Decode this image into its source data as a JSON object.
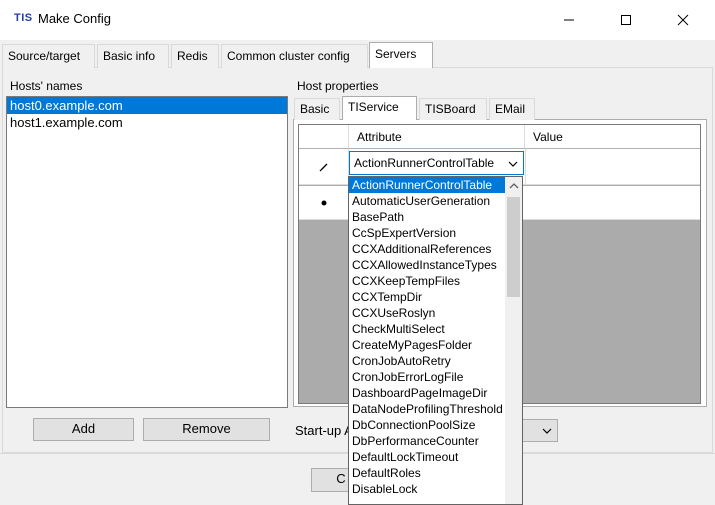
{
  "window": {
    "logo": "TIS",
    "title": "Make Config"
  },
  "tabs": [
    {
      "label": "Source/target"
    },
    {
      "label": "Basic info"
    },
    {
      "label": "Redis"
    },
    {
      "label": "Common cluster config"
    },
    {
      "label": "Servers",
      "active": true
    }
  ],
  "hosts": {
    "label": "Hosts' names",
    "items": [
      "host0.example.com",
      "host1.example.com"
    ],
    "selected_index": 0,
    "add_label": "Add",
    "remove_label": "Remove"
  },
  "host_properties": {
    "label": "Host properties",
    "tabs": [
      {
        "label": "Basic"
      },
      {
        "label": "TIService",
        "active": true
      },
      {
        "label": "TISBoard"
      },
      {
        "label": "EMail"
      }
    ],
    "grid": {
      "columns": [
        "Attribute",
        "Value"
      ],
      "row_markers": [
        "pencil",
        "asterisk"
      ],
      "current_attribute": "ActionRunnerControlTable"
    }
  },
  "startup": {
    "label": "Start-up A"
  },
  "bottom_button": {
    "label": "C"
  },
  "dropdown": {
    "items": [
      "ActionRunnerControlTable",
      "AutomaticUserGeneration",
      "BasePath",
      "CcSpExpertVersion",
      "CCXAdditionalReferences",
      "CCXAllowedInstanceTypes",
      "CCXKeepTempFiles",
      "CCXTempDir",
      "CCXUseRoslyn",
      "CheckMultiSelect",
      "CreateMyPagesFolder",
      "CronJobAutoRetry",
      "CronJobErrorLogFile",
      "DashboardPageImageDir",
      "DataNodeProfilingThreshold",
      "DbConnectionPoolSize",
      "DbPerformanceCounter",
      "DefaultLockTimeout",
      "DefaultRoles",
      "DisableLock"
    ],
    "selected_index": 0
  }
}
